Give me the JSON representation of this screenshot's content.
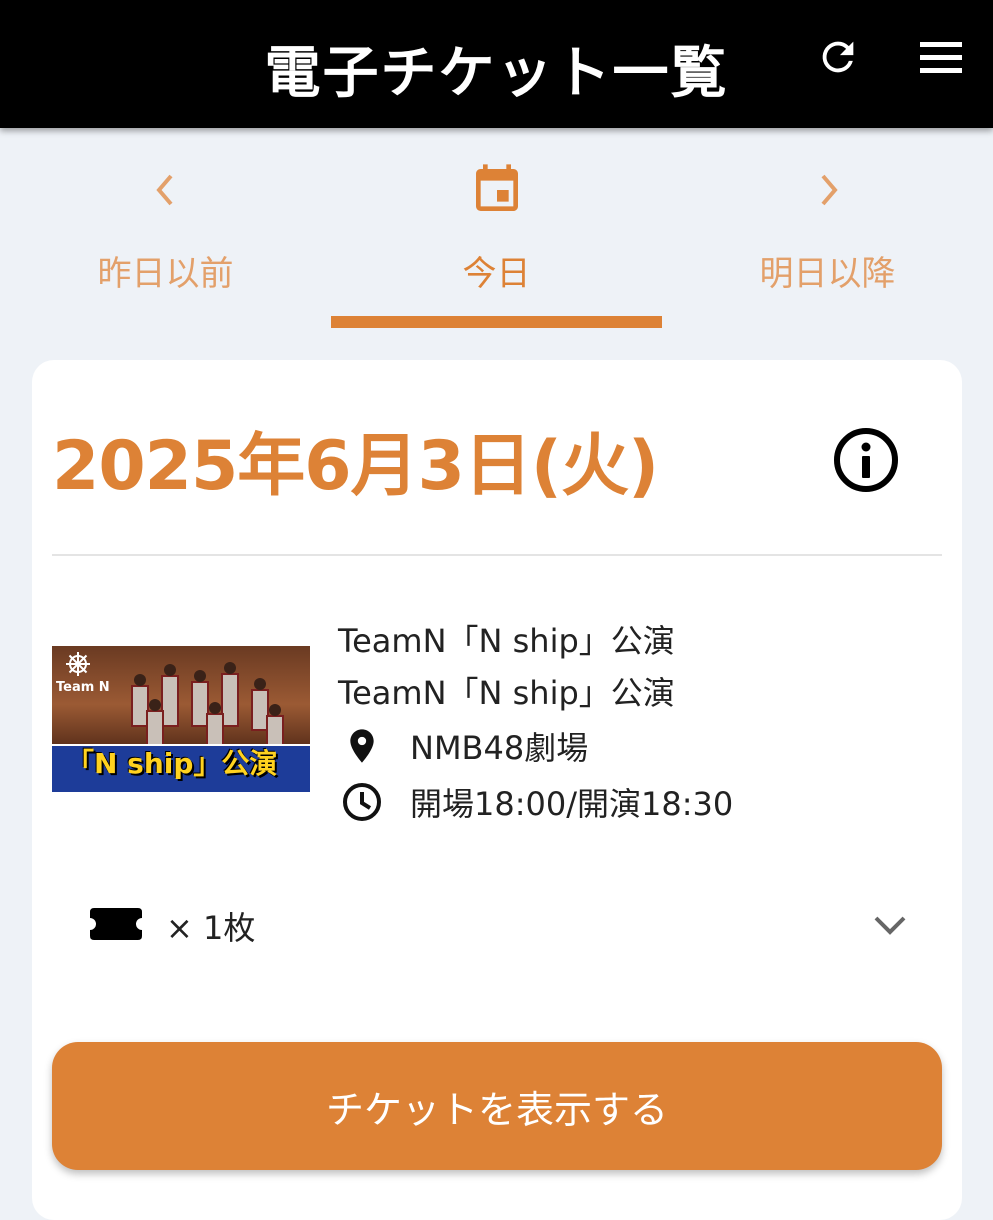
{
  "header": {
    "title": "電子チケット一覧",
    "refresh_icon": "refresh-icon",
    "menu_icon": "hamburger-menu-icon"
  },
  "tabs": [
    {
      "label": "昨日以前",
      "icon": "chevron-left-icon",
      "active": false
    },
    {
      "label": "今日",
      "icon": "calendar-icon",
      "active": true
    },
    {
      "label": "明日以降",
      "icon": "chevron-right-icon",
      "active": false
    }
  ],
  "card": {
    "date": "2025年6月3日(火)",
    "info_icon": "info-icon",
    "thumbnail": {
      "logo_text": "Team N",
      "banner_text": "「N ship」公演"
    },
    "event_title": "TeamN「N ship」公演",
    "event_subtitle": "TeamN「N ship」公演",
    "venue": "NMB48劇場",
    "time": "開場18:00/開演18:30",
    "ticket_count": "× 1枚",
    "show_button": "チケットを表示する"
  },
  "colors": {
    "accent": "#dd8236",
    "accent_light": "#e3a06a",
    "header_bg": "#000000",
    "page_bg": "#eef2f7"
  }
}
